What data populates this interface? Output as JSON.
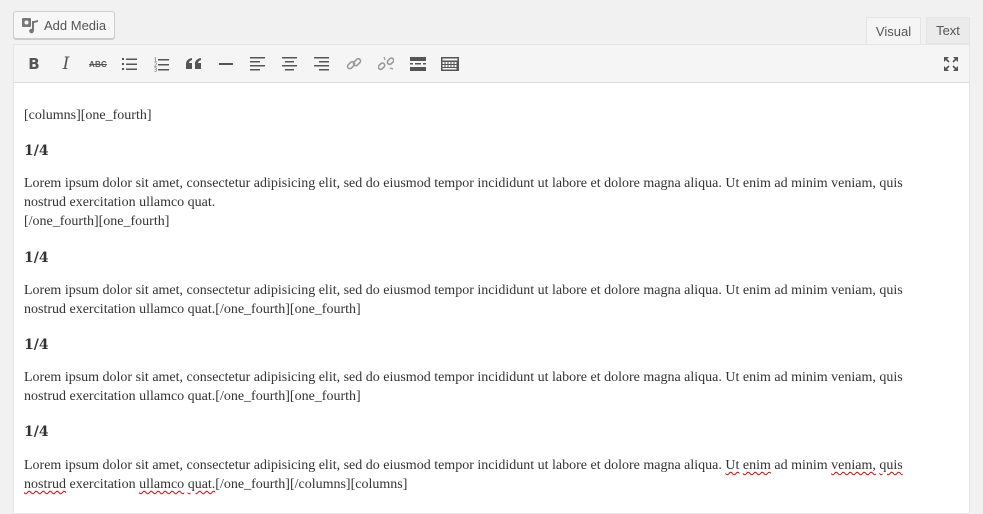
{
  "header": {
    "add_media_label": "Add Media",
    "tabs": [
      {
        "label": "Visual",
        "active": true
      },
      {
        "label": "Text",
        "active": false
      }
    ]
  },
  "toolbar": {
    "buttons": [
      {
        "name": "bold",
        "label": "B",
        "icon": "bold-icon"
      },
      {
        "name": "italic",
        "label": "I",
        "icon": "italic-icon"
      },
      {
        "name": "strikethrough",
        "label": "ABC",
        "icon": "strikethrough-icon"
      },
      {
        "name": "bulleted-list",
        "icon": "bulleted-list-icon"
      },
      {
        "name": "numbered-list",
        "icon": "numbered-list-icon"
      },
      {
        "name": "blockquote",
        "icon": "blockquote-icon"
      },
      {
        "name": "horizontal-line",
        "icon": "horizontal-line-icon"
      },
      {
        "name": "align-left",
        "icon": "align-left-icon"
      },
      {
        "name": "align-center",
        "icon": "align-center-icon"
      },
      {
        "name": "align-right",
        "icon": "align-right-icon"
      },
      {
        "name": "insert-link",
        "icon": "link-icon"
      },
      {
        "name": "remove-link",
        "icon": "unlink-icon"
      },
      {
        "name": "read-more",
        "icon": "read-more-icon"
      },
      {
        "name": "toolbar-toggle",
        "icon": "keyboard-icon"
      },
      {
        "name": "fullscreen",
        "icon": "fullscreen-icon"
      }
    ]
  },
  "content": {
    "line1": "[columns][one_fourth]",
    "heading1": "1/4",
    "para1_line1": "Lorem ipsum dolor sit amet, consectetur adipisicing elit, sed do eiusmod tempor incididunt ut labore et dolore magna aliqua. Ut enim ad minim veniam, quis",
    "para1_line2": "nostrud exercitation ullamco quat.",
    "para1_line3": "[/one_fourth][one_fourth]",
    "heading2": "1/4",
    "para2_line1": "Lorem ipsum dolor sit amet, consectetur adipisicing elit, sed do eiusmod tempor incididunt ut labore et dolore magna aliqua. Ut enim ad minim veniam, quis",
    "para2_line2": "nostrud exercitation ullamco quat.[/one_fourth][one_fourth]",
    "heading3": "1/4",
    "para3_line1": "Lorem ipsum dolor sit amet, consectetur adipisicing elit, sed do eiusmod tempor incididunt ut labore et dolore magna aliqua. Ut enim ad minim veniam, quis",
    "para3_line2": "nostrud exercitation ullamco quat.[/one_fourth][one_fourth]",
    "heading4": "1/4",
    "para4_line1_a": "Lorem ipsum dolor sit amet, consectetur adipisicing elit, sed do eiusmod tempor incididunt ut labore et dolore magna aliqua. ",
    "para4_ut": "Ut",
    "para4_sp1": " ",
    "para4_enim": "enim",
    "para4_ad": " ad minim ",
    "para4_veniam": "veniam,",
    "para4_sp2": " ",
    "para4_quis": "quis",
    "para4_nostrud": "nostrud",
    "para4_exercitation": " exercitation ",
    "para4_ullamco": "ullamco",
    "para4_sp3": " ",
    "para4_quat": "quat.",
    "para4_tail": "[/one_fourth][/columns][columns]"
  },
  "colors": {
    "background": "#f1f1f1",
    "toolbar": "#f5f5f5",
    "editor": "#ffffff",
    "text": "#333333",
    "icon": "#555555",
    "spellcheck": "#dd0000"
  }
}
